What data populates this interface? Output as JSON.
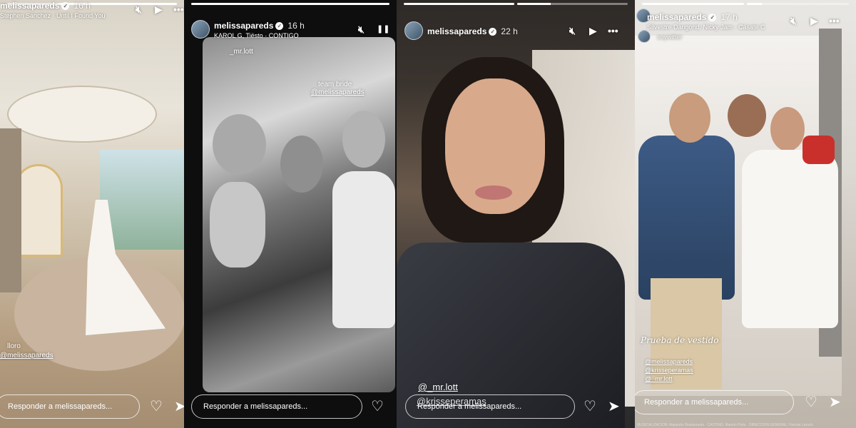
{
  "panels": [
    {
      "username": "melissapareds",
      "time": "16 h",
      "music": "Stephen Sanchez · Until I Found You",
      "progress": [
        1.0
      ],
      "tags": [
        "lloro",
        "@melissapareds"
      ],
      "reply_placeholder": "Responder a melissapareds..."
    },
    {
      "username": "melissapareds",
      "time": "16 h",
      "music": "KAROL G, Tiësto · CONTIGO",
      "progress": [
        1.0
      ],
      "tags": [
        "_mr.lott",
        "team bride",
        "@melissapareds"
      ],
      "reply_placeholder": "Responder a melissapareds..."
    },
    {
      "username": "melissapareds",
      "time": "22 h",
      "music": "",
      "progress": [
        1.0,
        0.3
      ],
      "tags": [
        "@_mr.lott",
        "@krisseperamas"
      ],
      "reply_placeholder": "Responder a melissapareds..."
    },
    {
      "username": "melissapareds",
      "time": "17 h",
      "music": "Silvestre Dangond, Nicky Jam · Cásate C",
      "progress": [
        1.0,
        0.15
      ],
      "tags": [
        "soywitter",
        "Prueba de vestido",
        "@melissapareds",
        "@krisseperamas",
        "@_mr.lott"
      ],
      "reply_placeholder": "Responder a melissapareds...",
      "footer": "MUSICALIZACIÓN: Alejandro Bustamante · CASTING: Ramón Pinto · DIRECCIÓN GENERAL: Hernán Larraín"
    }
  ],
  "icons": {
    "mute": "🔇︎",
    "play": "▶",
    "pause": "❚❚",
    "more": "•••",
    "heart": "♡",
    "send": "➤",
    "verified": "✓"
  }
}
